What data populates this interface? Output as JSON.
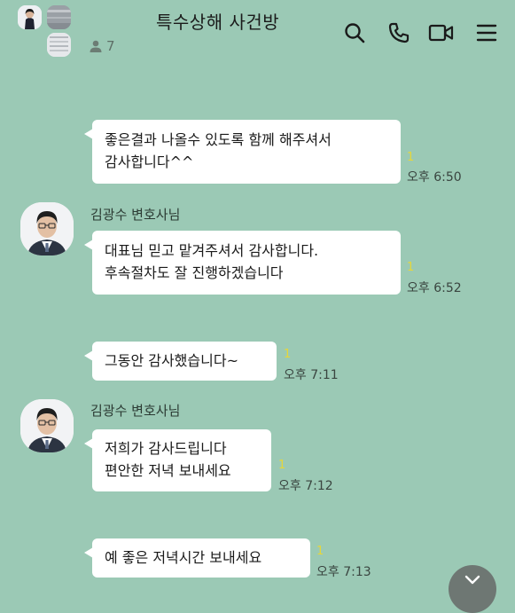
{
  "header": {
    "title": "특수상해 사건방",
    "member_count": "7",
    "icons": [
      "search-icon",
      "phone-icon",
      "video-call-icon",
      "menu-icon"
    ]
  },
  "messages": [
    {
      "type": "me",
      "lines": [
        "좋은결과 나올수 있도록 함께 해주셔서",
        "감사합니다^^"
      ],
      "unread": "1",
      "time": "오후 6:50"
    },
    {
      "type": "other",
      "sender": "김광수 변호사님",
      "lines": [
        "대표님 믿고 맡겨주셔서 감사합니다.",
        "후속절차도 잘 진행하겠습니다"
      ],
      "unread": "1",
      "time": "오후 6:52"
    },
    {
      "type": "me",
      "lines": [
        "그동안 감사했습니다~"
      ],
      "unread": "1",
      "time": "오후 7:11"
    },
    {
      "type": "other",
      "sender": "김광수 변호사님",
      "lines": [
        "저희가 감사드립니다",
        "편안한 저녁 보내세요"
      ],
      "unread": "1",
      "time": "오후 7:12"
    },
    {
      "type": "me",
      "lines": [
        "예 좋은 저녁시간 보내세요"
      ],
      "unread": "1",
      "time": "오후 7:13"
    }
  ],
  "colors": {
    "background": "#9bc9b5",
    "bubble": "#ffffff",
    "unread": "#e6d73a"
  }
}
